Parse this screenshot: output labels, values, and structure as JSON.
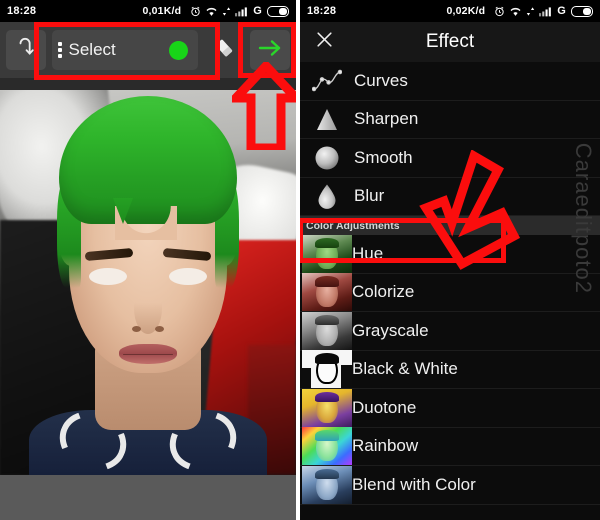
{
  "left_panel": {
    "statusbar": {
      "time": "18:28",
      "data_rate": "0,01K/d",
      "network_label": "G",
      "icons": [
        "alarm-icon",
        "wifi-icon",
        "data-transfer-icon",
        "signal-icon",
        "battery-icon"
      ]
    },
    "toolbar": {
      "undo_label": "undo-icon",
      "menu_label": "kebab-menu-icon",
      "select_label": "Select",
      "color_dot": "#18d518",
      "eraser_label": "eraser-icon",
      "apply_arrow_label": "apply-arrow-icon",
      "apply_arrow_color": "#2ad52a"
    },
    "annotations": {
      "select_box": "highlight-box",
      "apply_box": "highlight-box",
      "up_arrow": "pointer-arrow-up"
    }
  },
  "right_panel": {
    "statusbar": {
      "time": "18:28",
      "data_rate": "0,02K/d",
      "network_label": "G",
      "icons": [
        "alarm-icon",
        "wifi-icon",
        "data-transfer-icon",
        "signal-icon",
        "battery-icon"
      ]
    },
    "header": {
      "close_label": "close-icon",
      "title": "Effect"
    },
    "watermark": "Caraeditpoto2",
    "items": [
      {
        "label": "Curves",
        "icon": "curves-icon",
        "type": "icon",
        "selected": false
      },
      {
        "label": "Sharpen",
        "icon": "triangle-icon",
        "type": "icon",
        "selected": false
      },
      {
        "label": "Smooth",
        "icon": "sphere-icon",
        "type": "icon",
        "selected": false
      },
      {
        "label": "Blur",
        "icon": "droplet-icon",
        "type": "icon",
        "selected": false
      },
      {
        "label": "Color Adjustments",
        "icon": "",
        "type": "section",
        "selected": false
      },
      {
        "label": "Hue",
        "icon": "thumb-hue",
        "type": "thumb",
        "selected": false
      },
      {
        "label": "Colorize",
        "icon": "thumb-colorize",
        "type": "thumb",
        "selected": true
      },
      {
        "label": "Grayscale",
        "icon": "thumb-grayscale",
        "type": "thumb",
        "selected": false
      },
      {
        "label": "Black & White",
        "icon": "thumb-bw",
        "type": "thumb",
        "selected": false
      },
      {
        "label": "Duotone",
        "icon": "thumb-duotone",
        "type": "thumb",
        "selected": false
      },
      {
        "label": "Rainbow",
        "icon": "thumb-rainbow",
        "type": "thumb",
        "selected": false
      },
      {
        "label": "Blend with Color",
        "icon": "thumb-blend",
        "type": "thumb",
        "selected": false
      }
    ],
    "annotations": {
      "colorize_box": "highlight-box",
      "down_arrow": "pointer-arrow-down-left"
    }
  },
  "colors": {
    "annotation_red": "#fb0d0d",
    "accent_green": "#2ad52a",
    "panel_bg": "#0c0c0c",
    "toolbar_bg": "#3a3a3a"
  }
}
